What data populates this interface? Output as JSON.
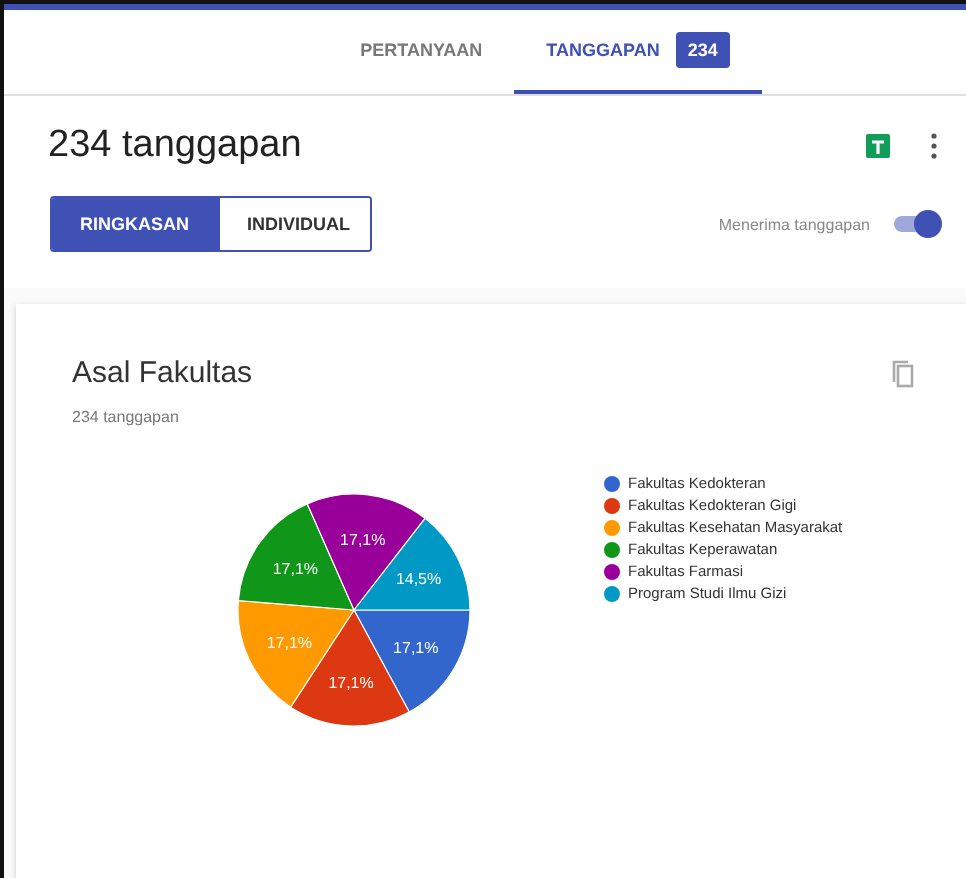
{
  "tabs": [
    {
      "label": "PERTANYAAN",
      "selected": false
    },
    {
      "label": "TANGGAPAN",
      "selected": true,
      "badge": "234"
    }
  ],
  "heading": "234 tanggapan",
  "view_switch": [
    {
      "label": "RINGKASAN",
      "selected": true
    },
    {
      "label": "INDIVIDUAL",
      "selected": false
    }
  ],
  "accepting": {
    "label": "Menerima tanggapan",
    "on": true
  },
  "card": {
    "title": "Asal Fakultas",
    "subtitle": "234 tanggapan",
    "chart_data": {
      "type": "pie",
      "categories": [
        "Fakultas Kedokteran",
        "Fakultas Kedokteran Gigi",
        "Fakultas Kesehatan Masyarakat",
        "Fakultas Keperawatan",
        "Fakultas Farmasi",
        "Program Studi Ilmu Gizi"
      ],
      "legend": true,
      "series": [
        {
          "colors": [
            "#3366cc",
            "#dc3912",
            "#ff9900",
            "#109618",
            "#990099",
            "#0099c6"
          ],
          "values": [
            17.1,
            17.1,
            17.1,
            17.1,
            17.1,
            14.5
          ]
        }
      ],
      "value_labels": [
        "17,1%",
        "17,1%",
        "17,1%",
        "17,1%",
        "17,1%",
        "14,5%"
      ]
    }
  }
}
